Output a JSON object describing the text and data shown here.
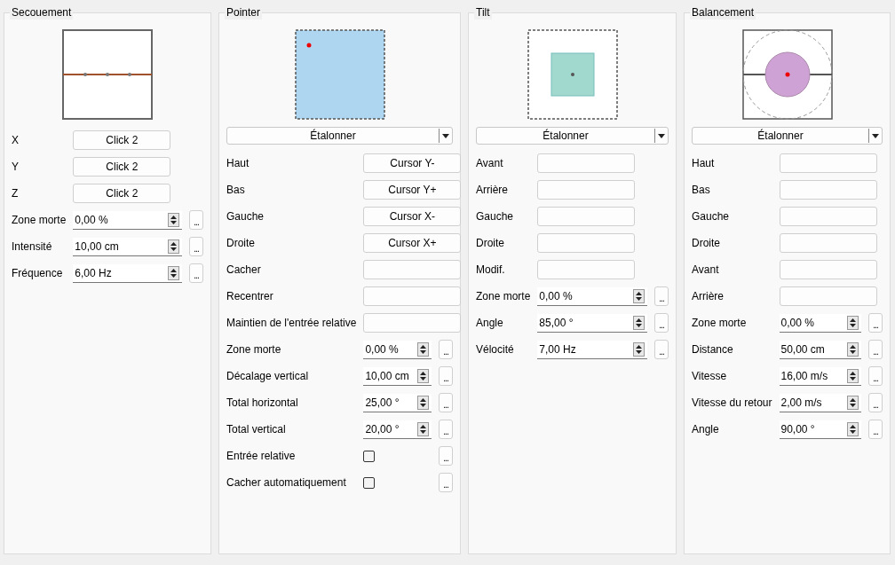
{
  "panels": [
    {
      "title": "Secouement",
      "preview": {
        "kind": "shake"
      },
      "rows": [
        {
          "kind": "button",
          "label": "X",
          "value": "Click 2"
        },
        {
          "kind": "button",
          "label": "Y",
          "value": "Click 2"
        },
        {
          "kind": "button",
          "label": "Z",
          "value": "Click 2"
        },
        {
          "kind": "spin",
          "label": "Zone morte",
          "value": "0,00 %",
          "more": "..."
        },
        {
          "kind": "spin",
          "label": "Intensité",
          "value": "10,00 cm",
          "more": "..."
        },
        {
          "kind": "spin",
          "label": "Fréquence",
          "value": "6,00 Hz",
          "more": "..."
        }
      ]
    },
    {
      "title": "Pointer",
      "preview": {
        "kind": "pointer"
      },
      "calibrate": "Étalonner",
      "rows": [
        {
          "kind": "button",
          "label": "Haut",
          "value": "Cursor Y-"
        },
        {
          "kind": "button",
          "label": "Bas",
          "value": "Cursor Y+"
        },
        {
          "kind": "button",
          "label": "Gauche",
          "value": "Cursor X-"
        },
        {
          "kind": "button",
          "label": "Droite",
          "value": "Cursor X+"
        },
        {
          "kind": "binding",
          "label": "Cacher"
        },
        {
          "kind": "binding",
          "label": "Recentrer"
        },
        {
          "kind": "binding",
          "label": "Maintien de l'entrée relative"
        },
        {
          "kind": "spin",
          "label": "Zone morte",
          "value": "0,00 %",
          "more": "..."
        },
        {
          "kind": "spin",
          "label": "Décalage vertical",
          "value": "10,00 cm",
          "more": "..."
        },
        {
          "kind": "spin",
          "label": "Total horizontal",
          "value": "25,00 °",
          "more": "..."
        },
        {
          "kind": "spin",
          "label": "Total vertical",
          "value": "20,00 °",
          "more": "..."
        },
        {
          "kind": "checkbox",
          "label": "Entrée relative",
          "checked": false,
          "more": "..."
        },
        {
          "kind": "checkbox",
          "label": "Cacher automatiquement",
          "checked": false,
          "more": "..."
        }
      ]
    },
    {
      "title": "Tilt",
      "preview": {
        "kind": "tilt"
      },
      "calibrate": "Étalonner",
      "rows": [
        {
          "kind": "binding",
          "label": "Avant"
        },
        {
          "kind": "binding",
          "label": "Arrière"
        },
        {
          "kind": "binding",
          "label": "Gauche"
        },
        {
          "kind": "binding",
          "label": "Droite"
        },
        {
          "kind": "binding",
          "label": "Modif."
        },
        {
          "kind": "spin",
          "label": "Zone morte",
          "value": "0,00 %",
          "more": "..."
        },
        {
          "kind": "spin",
          "label": "Angle",
          "value": "85,00 °",
          "more": "..."
        },
        {
          "kind": "spin",
          "label": "Vélocité",
          "value": "7,00 Hz",
          "more": "..."
        }
      ]
    },
    {
      "title": "Balancement",
      "preview": {
        "kind": "swing"
      },
      "calibrate": "Étalonner",
      "rows": [
        {
          "kind": "binding",
          "label": "Haut"
        },
        {
          "kind": "binding",
          "label": "Bas"
        },
        {
          "kind": "binding",
          "label": "Gauche"
        },
        {
          "kind": "binding",
          "label": "Droite"
        },
        {
          "kind": "binding",
          "label": "Avant"
        },
        {
          "kind": "binding",
          "label": "Arrière"
        },
        {
          "kind": "spin",
          "label": "Zone morte",
          "value": "0,00 %",
          "more": "..."
        },
        {
          "kind": "spin",
          "label": "Distance",
          "value": "50,00 cm",
          "more": "..."
        },
        {
          "kind": "spin",
          "label": "Vitesse",
          "value": "16,00 m/s",
          "more": "..."
        },
        {
          "kind": "spin",
          "label": "Vitesse du retour",
          "value": "2,00 m/s",
          "more": "..."
        },
        {
          "kind": "spin",
          "label": "Angle",
          "value": "90,00 °",
          "more": "..."
        }
      ]
    }
  ]
}
